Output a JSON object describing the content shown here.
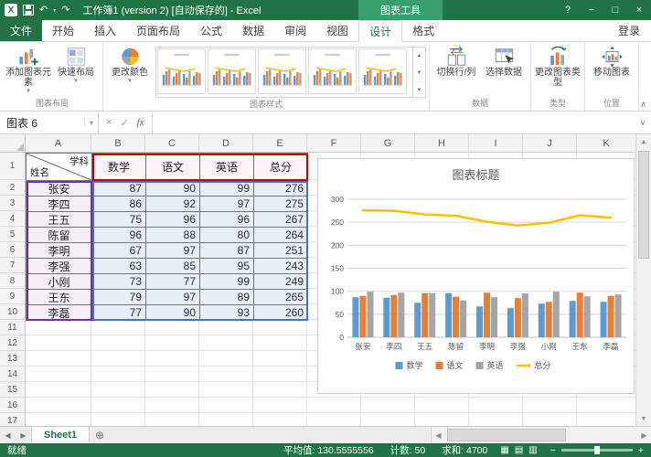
{
  "icons": {
    "excel_logo": "X",
    "undo": "↶",
    "redo": "↷",
    "caret_down": "▾",
    "help": "?",
    "minimize": "−",
    "maximize": "□",
    "close": "×",
    "cancel": "×",
    "enter": "✓",
    "fx": "fx",
    "expand_formula_bar": "∨",
    "collapse_ribbon": "∧",
    "nav_left": "◀",
    "nav_right": "▶",
    "add_sheet": "⊕",
    "scroll_up": "▲",
    "scroll_down": "▼",
    "scroll_left": "◀",
    "scroll_right": "▶",
    "gallery_up": "▲",
    "gallery_down": "▼",
    "gallery_more": "▼",
    "view_normal": "▦",
    "view_page_layout": "▤",
    "view_page_break": "▥",
    "zoom_out": "−",
    "zoom_in": "+"
  },
  "titlebar": {
    "title": "工作簿1 (version 2) [自动保存的] - Excel",
    "contextual_group": "图表工具"
  },
  "tabs": {
    "file": "文件",
    "main": [
      "开始",
      "插入",
      "页面布局",
      "公式",
      "数据",
      "审阅",
      "视图"
    ],
    "contextual": [
      "设计",
      "格式"
    ],
    "active_contextual": "设计",
    "sign_in": "登录"
  },
  "ribbon": {
    "add_chart_element": "添加图表元素",
    "quick_layout": "快速布局",
    "change_colors": "更改颜色",
    "switch_row_col": "切换行/列",
    "select_data": "选择数据",
    "change_chart_type": "更改图表类型",
    "move_chart": "移动图表",
    "groups": {
      "layout": "图表布局",
      "styles": "图表样式",
      "data": "数据",
      "type": "类型",
      "location": "位置"
    }
  },
  "formula_bar": {
    "name_box": "图表 6"
  },
  "sheet": {
    "columns": [
      "A",
      "B",
      "C",
      "D",
      "E",
      "F",
      "G",
      "H",
      "I",
      "J",
      "K"
    ],
    "row_count": 17,
    "table": {
      "corner_top": "学科",
      "corner_bottom": "姓名",
      "headers": [
        "数学",
        "语文",
        "英语",
        "总分"
      ],
      "rows": [
        {
          "name": "张安",
          "values": [
            87,
            90,
            99,
            276
          ]
        },
        {
          "name": "李四",
          "values": [
            86,
            92,
            97,
            275
          ]
        },
        {
          "name": "王五",
          "values": [
            75,
            96,
            96,
            267
          ]
        },
        {
          "name": "陈留",
          "values": [
            96,
            88,
            80,
            264
          ]
        },
        {
          "name": "李明",
          "values": [
            67,
            97,
            87,
            251
          ]
        },
        {
          "name": "李强",
          "values": [
            63,
            85,
            95,
            243
          ]
        },
        {
          "name": "小刚",
          "values": [
            73,
            77,
            99,
            249
          ]
        },
        {
          "name": "王东",
          "values": [
            79,
            97,
            89,
            265
          ]
        },
        {
          "name": "李磊",
          "values": [
            77,
            90,
            93,
            260
          ]
        }
      ]
    }
  },
  "chart_data": {
    "type": "combo",
    "title": "图表标题",
    "categories": [
      "张安",
      "李四",
      "王五",
      "陈留",
      "李明",
      "李强",
      "小刚",
      "王东",
      "李磊"
    ],
    "series": [
      {
        "name": "数学",
        "type": "bar",
        "color": "#5B9BD5",
        "values": [
          87,
          86,
          75,
          96,
          67,
          63,
          73,
          79,
          77
        ]
      },
      {
        "name": "语文",
        "type": "bar",
        "color": "#ED7D31",
        "values": [
          90,
          92,
          96,
          88,
          97,
          85,
          77,
          97,
          90
        ]
      },
      {
        "name": "英语",
        "type": "bar",
        "color": "#A5A5A5",
        "values": [
          99,
          97,
          96,
          80,
          87,
          95,
          99,
          89,
          93
        ]
      },
      {
        "name": "总分",
        "type": "line",
        "color": "#FFC000",
        "values": [
          276,
          275,
          267,
          264,
          251,
          243,
          249,
          265,
          260
        ]
      }
    ],
    "ylim": [
      0,
      300
    ],
    "ytick": 50,
    "grid": true,
    "legend_position": "bottom"
  },
  "sheet_tabs": {
    "active": "Sheet1"
  },
  "status_bar": {
    "ready": "就绪",
    "average": "平均值: 130.5555556",
    "count": "计数: 50",
    "sum": "求和: 4700"
  },
  "colors": {
    "excel_green": "#217346",
    "series_math": "#5B9BD5",
    "series_chinese": "#ED7D31",
    "series_english": "#A5A5A5",
    "series_total": "#FFC000",
    "highlight_values": "#4472C4",
    "highlight_categories": "#7030A0",
    "highlight_series_names": "#C00000"
  }
}
